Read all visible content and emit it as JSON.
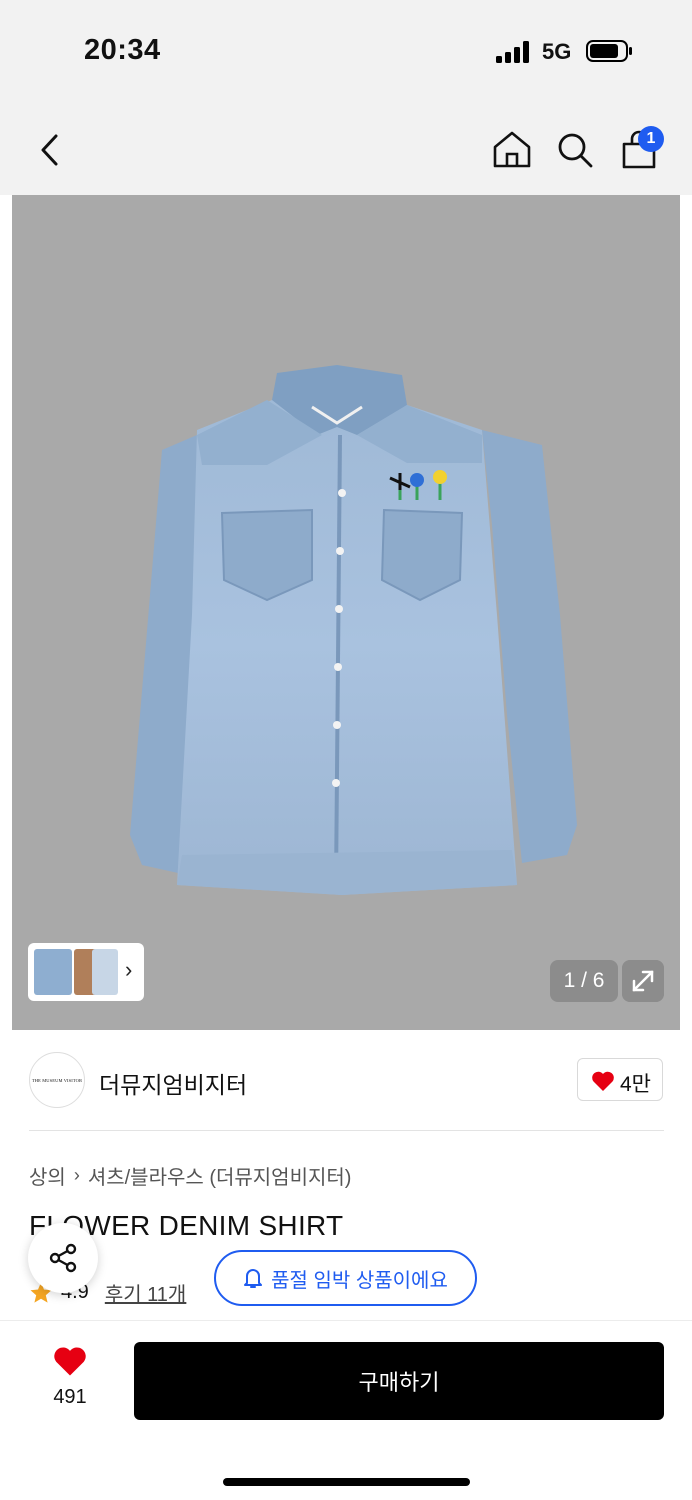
{
  "status_bar": {
    "time": "20:34",
    "network": "5G"
  },
  "header": {
    "cart_count": "1"
  },
  "gallery": {
    "counter": "1 / 6"
  },
  "brand": {
    "logo_text": "THE MUSEUM VISITOR",
    "name": "더뮤지엄비지터",
    "likes": "4만"
  },
  "breadcrumb": {
    "level1": "상의",
    "level2": "셔츠/블라우스 (더뮤지엄비지터)"
  },
  "product": {
    "title": "FLOWER DENIM SHIRT",
    "rating": "4.9",
    "reviews": "후기 11개"
  },
  "notice": {
    "label": "품절 임박 상품이에요"
  },
  "bottom_bar": {
    "wish_count": "491",
    "buy_label": "구매하기"
  },
  "colors": {
    "accent": "#1f5cf0",
    "heart": "#e60012",
    "image_bg": "#a9a9a9"
  }
}
